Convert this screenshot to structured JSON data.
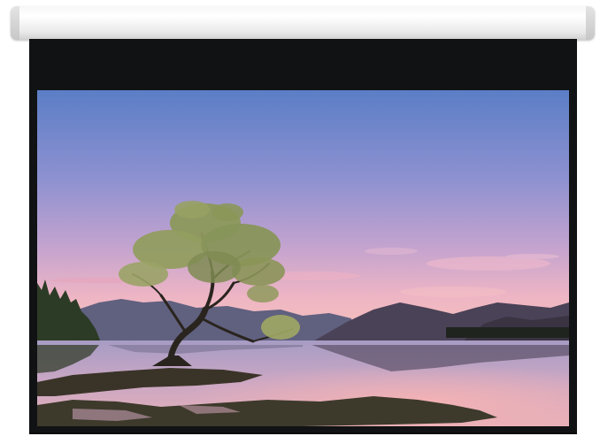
{
  "product": {
    "type": "motorized-projection-screen",
    "casing_color": "#f2f2f2",
    "border_color": "#111214"
  },
  "projected_image": {
    "scene": "lone-tree-in-lake-at-dusk",
    "colors": {
      "sky_top": "#5e7fc4",
      "sky_mid": "#9a90cc",
      "sky_horizon": "#f1b2bd",
      "mountains_far": "#5d5a7d",
      "mountains_near": "#3e3646",
      "water": "#b49ab8",
      "water_glow": "#f4aab2",
      "shore": "#34312a",
      "foliage": "#8f9a5d",
      "trunk": "#2c2620"
    }
  }
}
